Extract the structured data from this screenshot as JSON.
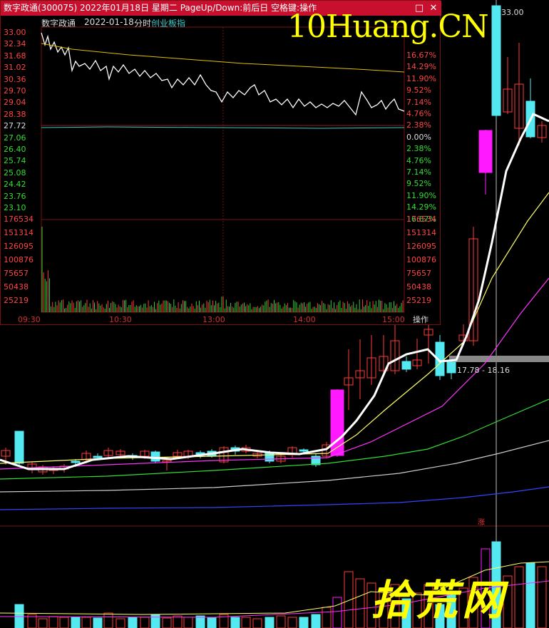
{
  "window": {
    "title": "数字政通(300075) 2022年01月18日 星期二 PageUp/Down:前后日 空格键:操作",
    "buttons": [
      "□",
      "✕"
    ]
  },
  "intraday": {
    "stock_name": "数字政通",
    "date": "2022-01-18",
    "mode": "分时",
    "board": "创业板指",
    "operate_label": "操作",
    "price_ticks": [
      "33.00",
      "32.34",
      "31.68",
      "31.02",
      "30.36",
      "29.70",
      "29.04",
      "28.38",
      "27.72",
      "27.06",
      "26.40",
      "25.74",
      "25.08",
      "24.42",
      "23.76",
      "23.10"
    ],
    "pct_ticks": [
      "16.67%",
      "14.29%",
      "11.90%",
      "9.52%",
      "7.14%",
      "4.76%",
      "2.38%",
      "0.00%",
      "2.38%",
      "4.76%",
      "7.14%",
      "9.52%",
      "11.90%",
      "14.29%",
      "16.67%"
    ],
    "volume_ticks": [
      "176534",
      "151314",
      "126095",
      "100876",
      "75657",
      "50438",
      "25219"
    ],
    "time_ticks": [
      "09:30",
      "10:30",
      "13:00",
      "14:00",
      "15:00"
    ]
  },
  "overlay": {
    "watermark_top": "10Huang.CN",
    "watermark_bottom": "拾荒网",
    "high_label": "33.00",
    "range_label": "17.78 - 18.16",
    "marker": "涨"
  },
  "colors": {
    "up": "#ff3b3b",
    "down": "#54e8f0",
    "limit_up": "#ff19ff",
    "ma5": "#ffffff",
    "ma10": "#ffff66",
    "ma20": "#ff33ff",
    "ma30": "#33dd33",
    "ma60": "#cccccc",
    "ma120": "#3344ff"
  }
}
